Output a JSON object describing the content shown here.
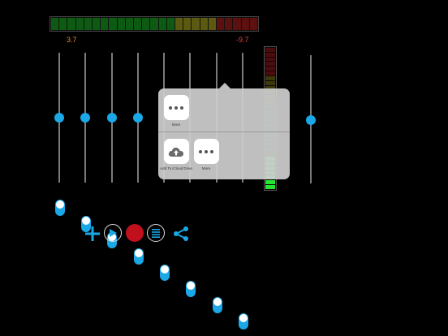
{
  "meter": {
    "left_readout": "3.7",
    "right_readout": "-9.7",
    "left_readout_color": "#e08a2a",
    "right_readout_color": "#e0443a",
    "segment_colors": [
      "#0d5a12",
      "#0d5a12",
      "#0d5a12",
      "#0d5a12",
      "#0d5a12",
      "#0d5a12",
      "#0d5a12",
      "#0d5a12",
      "#0d5a12",
      "#0d5a12",
      "#0d5a12",
      "#0d5a12",
      "#0d5a12",
      "#0d5a12",
      "#0d5a12",
      "#5c5a10",
      "#5c5a10",
      "#5c5a10",
      "#5c5a10",
      "#5c5a10",
      "#5c1010",
      "#5c1010",
      "#5c1010",
      "#5c1010",
      "#5c1010"
    ]
  },
  "sliders": {
    "channel_count": 9,
    "knob_color": "#1aa8e6",
    "track_color": "#7a7a7a"
  },
  "toggles": {
    "count": 8,
    "state": "on"
  },
  "toolbar": {
    "items": [
      {
        "name": "add-button",
        "icon": "plus-icon"
      },
      {
        "name": "play-button",
        "icon": "play-icon"
      },
      {
        "name": "record-button",
        "icon": "record-icon"
      },
      {
        "name": "list-button",
        "icon": "list-icon"
      },
      {
        "name": "share-button",
        "icon": "share-icon"
      }
    ],
    "accent": "#1aa8e6",
    "record_color": "#c0101c"
  },
  "share_sheet": {
    "row1": [
      {
        "label": "More",
        "icon": "more-icon"
      }
    ],
    "row2": [
      {
        "label": "Add To iCloud Drive",
        "icon": "cloud-upload-icon"
      },
      {
        "label": "More",
        "icon": "more-icon"
      }
    ]
  }
}
